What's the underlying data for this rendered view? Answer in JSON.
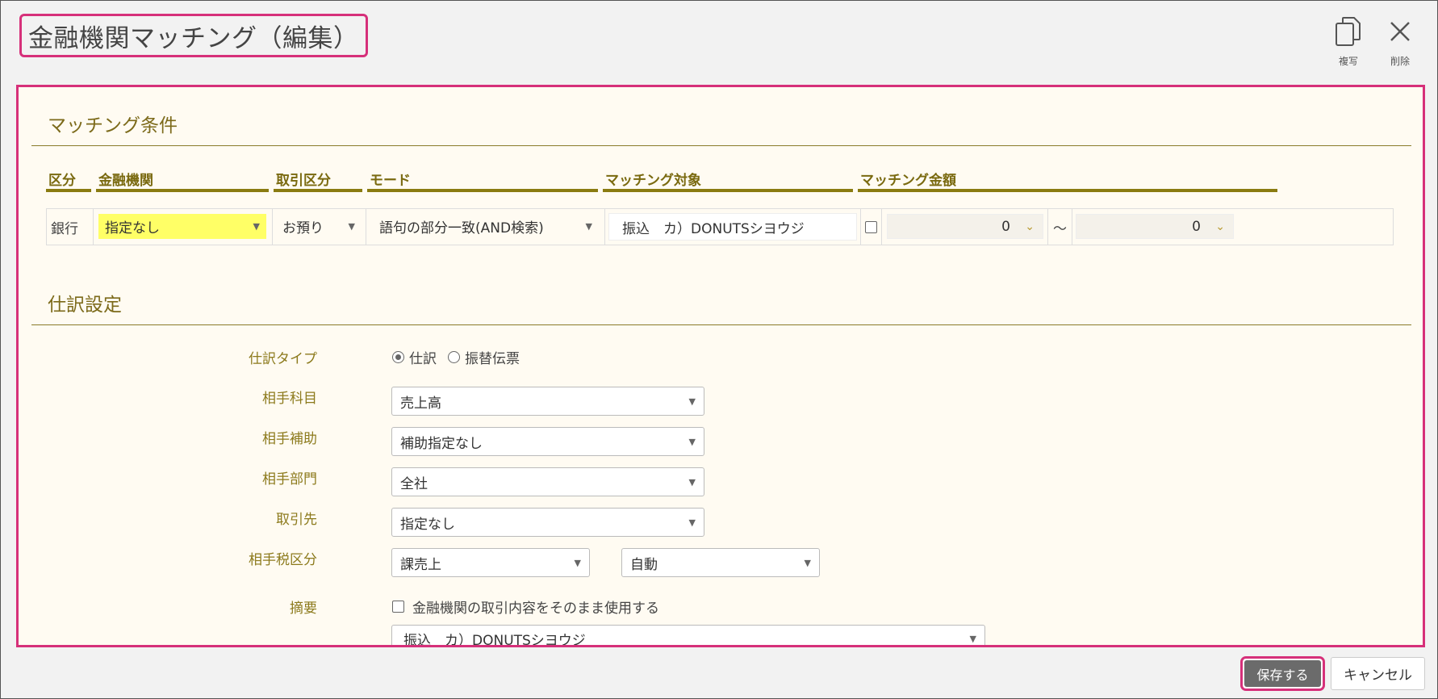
{
  "header": {
    "title": "金融機関マッチング（編集）",
    "tools": [
      {
        "label": "複写",
        "icon": "copy-icon"
      },
      {
        "label": "削除",
        "icon": "close-icon"
      }
    ]
  },
  "matching": {
    "section_title": "マッチング条件",
    "columns": [
      "区分",
      "金融機関",
      "取引区分",
      "モード",
      "マッチング対象",
      "マッチング金額"
    ],
    "row": {
      "kubun": "銀行",
      "institution": "指定なし",
      "transaction_type": "お預り",
      "mode": "語句の部分一致(AND検索)",
      "target": "振込　カ）DONUTSシヨウジ",
      "amount_from": "0",
      "amount_to": "0",
      "range_sep": "～"
    },
    "highlight_color": "#ffff66"
  },
  "journal": {
    "section_title": "仕訳設定",
    "type_label": "仕訳タイプ",
    "type_options": [
      "仕訳",
      "振替伝票"
    ],
    "type_selected": "仕訳",
    "account_label": "相手科目",
    "account_value": "売上高",
    "sub_label": "相手補助",
    "sub_value": "補助指定なし",
    "dept_label": "相手部門",
    "dept_value": "全社",
    "partner_label": "取引先",
    "partner_value": "指定なし",
    "tax_label": "相手税区分",
    "tax_value": "課売上",
    "tax_calc_value": "自動",
    "memo_label": "摘要",
    "memo_checkbox_label": "金融機関の取引内容をそのまま使用する",
    "memo_value": "振込　カ）DONUTSシヨウジ"
  },
  "footer": {
    "save_label": "保存する",
    "cancel_label": "キャンセル"
  },
  "colors": {
    "accent": "#d6307a",
    "olive": "#8a7b10",
    "panel_bg": "#fffbf2"
  }
}
